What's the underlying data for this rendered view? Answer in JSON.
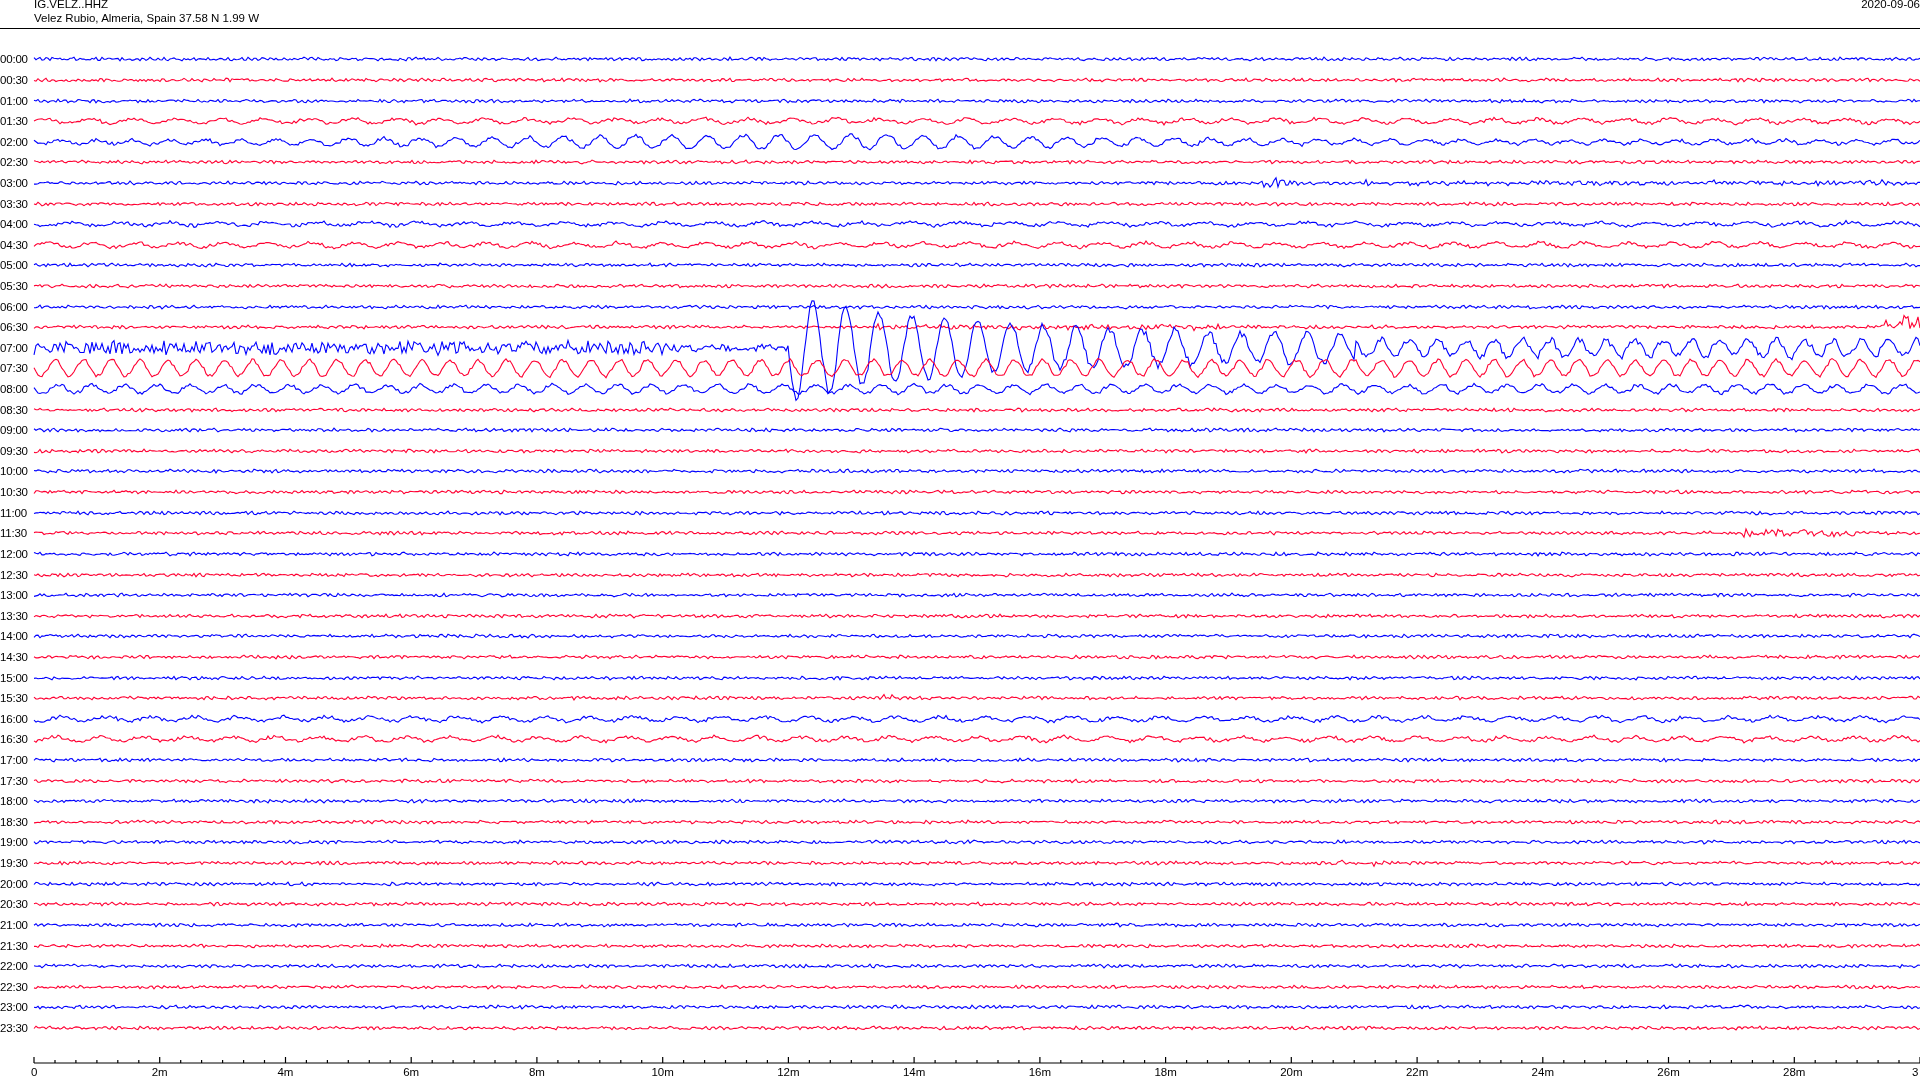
{
  "header": {
    "station": "IG.VELZ..HHZ",
    "location": "Velez Rubio, Almeria, Spain  37.58 N 1.99 W",
    "date": "2020-09-06"
  },
  "traces": [
    {
      "label": "00:00",
      "color": "#0000ff"
    },
    {
      "label": "00:30",
      "color": "#ff0033"
    },
    {
      "label": "01:00",
      "color": "#0000ff"
    },
    {
      "label": "01:30",
      "color": "#ff0033"
    },
    {
      "label": "02:00",
      "color": "#0000ff"
    },
    {
      "label": "02:30",
      "color": "#ff0033"
    },
    {
      "label": "03:00",
      "color": "#0000ff"
    },
    {
      "label": "03:30",
      "color": "#ff0033"
    },
    {
      "label": "04:00",
      "color": "#0000ff"
    },
    {
      "label": "04:30",
      "color": "#ff0033"
    },
    {
      "label": "05:00",
      "color": "#0000ff"
    },
    {
      "label": "05:30",
      "color": "#ff0033"
    },
    {
      "label": "06:00",
      "color": "#0000ff"
    },
    {
      "label": "06:30",
      "color": "#ff0033"
    },
    {
      "label": "07:00",
      "color": "#0000ff"
    },
    {
      "label": "07:30",
      "color": "#ff0033"
    },
    {
      "label": "08:00",
      "color": "#0000ff"
    },
    {
      "label": "08:30",
      "color": "#ff0033"
    },
    {
      "label": "09:00",
      "color": "#0000ff"
    },
    {
      "label": "09:30",
      "color": "#ff0033"
    },
    {
      "label": "10:00",
      "color": "#0000ff"
    },
    {
      "label": "10:30",
      "color": "#ff0033"
    },
    {
      "label": "11:00",
      "color": "#0000ff"
    },
    {
      "label": "11:30",
      "color": "#ff0033"
    },
    {
      "label": "12:00",
      "color": "#0000ff"
    },
    {
      "label": "12:30",
      "color": "#ff0033"
    },
    {
      "label": "13:00",
      "color": "#0000ff"
    },
    {
      "label": "13:30",
      "color": "#ff0033"
    },
    {
      "label": "14:00",
      "color": "#0000ff"
    },
    {
      "label": "14:30",
      "color": "#ff0033"
    },
    {
      "label": "15:00",
      "color": "#0000ff"
    },
    {
      "label": "15:30",
      "color": "#ff0033"
    },
    {
      "label": "16:00",
      "color": "#0000ff"
    },
    {
      "label": "16:30",
      "color": "#ff0033"
    },
    {
      "label": "17:00",
      "color": "#0000ff"
    },
    {
      "label": "17:30",
      "color": "#ff0033"
    },
    {
      "label": "18:00",
      "color": "#0000ff"
    },
    {
      "label": "18:30",
      "color": "#ff0033"
    },
    {
      "label": "19:00",
      "color": "#0000ff"
    },
    {
      "label": "19:30",
      "color": "#ff0033"
    },
    {
      "label": "20:00",
      "color": "#0000ff"
    },
    {
      "label": "20:30",
      "color": "#ff0033"
    },
    {
      "label": "21:00",
      "color": "#0000ff"
    },
    {
      "label": "21:30",
      "color": "#ff0033"
    },
    {
      "label": "22:00",
      "color": "#0000ff"
    },
    {
      "label": "22:30",
      "color": "#ff0033"
    },
    {
      "label": "23:00",
      "color": "#0000ff"
    },
    {
      "label": "23:30",
      "color": "#ff0033"
    }
  ],
  "time_axis": {
    "labels": [
      "0",
      "2m",
      "4m",
      "6m",
      "8m",
      "10m",
      "12m",
      "14m",
      "16m",
      "18m",
      "20m",
      "22m",
      "24m",
      "26m",
      "28m",
      "3"
    ]
  }
}
